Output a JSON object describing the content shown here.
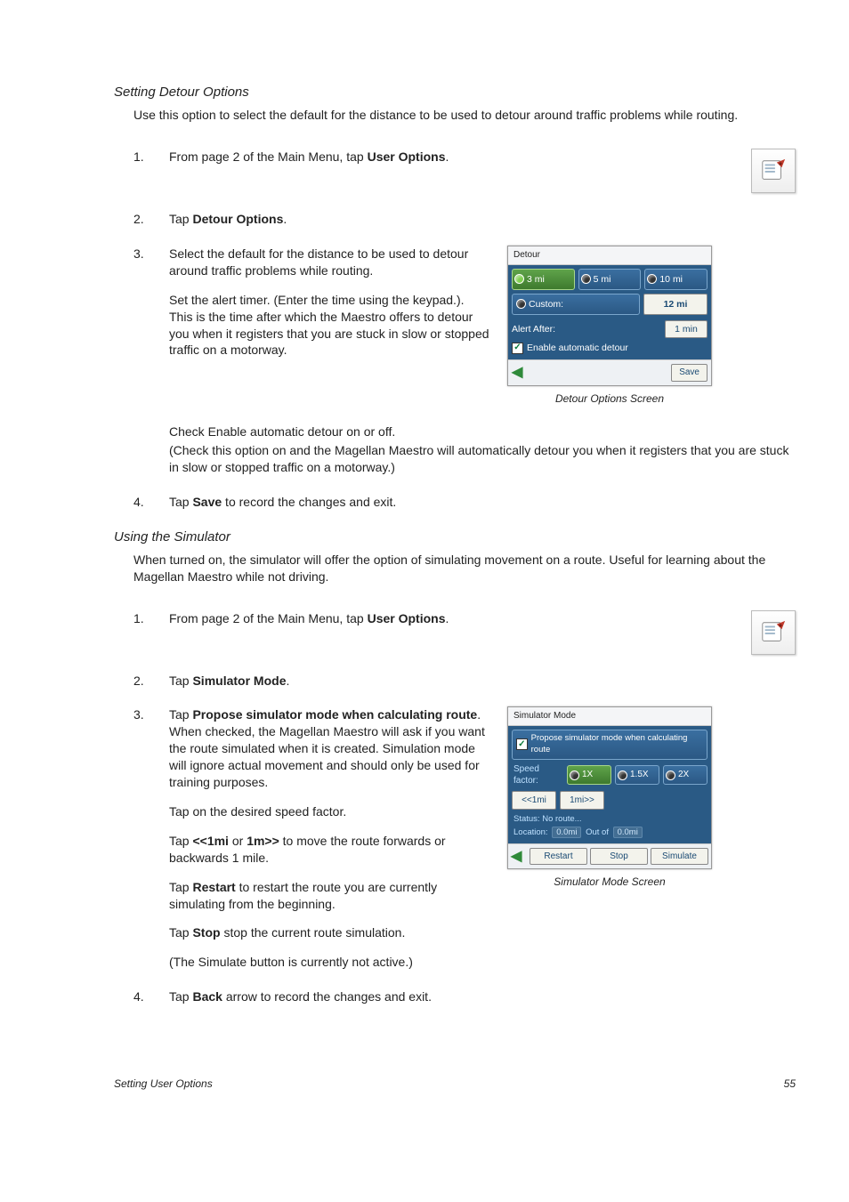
{
  "section1": {
    "title": "Setting Detour Options",
    "intro": "Use this option to select the default for the distance to be used to detour around traffic problems while routing.",
    "steps": {
      "s1": {
        "num": "1.",
        "pre": "From page 2 of the Main Menu, tap ",
        "bold": "User Options",
        "post": "."
      },
      "s2": {
        "num": "2.",
        "pre": "Tap ",
        "bold": "Detour Options",
        "post": "."
      },
      "s3": {
        "num": "3.",
        "p1": "Select the default for the distance to be used to detour around traffic problems while routing.",
        "p2": "Set the alert timer.  (Enter the time using the keypad.). This is the time after which the Maestro offers to detour you when it registers that you are stuck in slow or stopped traffic on a motorway.",
        "p3a": "Check Enable automatic detour on or off.",
        "p3b": "(Check this option on and the Magellan Maestro will automatically detour you when it registers that you are stuck in slow or stopped traffic on a motorway.)"
      },
      "s4": {
        "num": "4.",
        "pre": "Tap ",
        "bold": "Save",
        "post": " to record the changes and exit."
      }
    },
    "figure": {
      "title": "Detour",
      "opts": {
        "a": "3 mi",
        "b": "5 mi",
        "c": "10 mi"
      },
      "custom_label": "Custom:",
      "custom_val": "12 mi",
      "alert_label": "Alert After:",
      "alert_val": "1 min",
      "enable_label": "Enable automatic detour",
      "save": "Save",
      "caption": "Detour Options Screen"
    }
  },
  "section2": {
    "title": "Using the Simulator",
    "intro": "When turned on, the simulator will offer the option of simulating movement on a route.  Useful for learning about the Magellan Maestro while not driving.",
    "steps": {
      "s1": {
        "num": "1.",
        "pre": "From page 2 of the Main Menu, tap ",
        "bold": "User Options",
        "post": "."
      },
      "s2": {
        "num": "2.",
        "pre": "Tap ",
        "bold": "Simulator Mode",
        "post": "."
      },
      "s3": {
        "num": "3.",
        "p1_pre": "Tap ",
        "p1_bold": "Propose simulator mode when calculating route",
        "p1_post": ".  When checked, the Magellan Maestro will ask if you want the route simulated when it is created.  Simulation mode will ignore actual movement and should only be used for training purposes.",
        "p2": "Tap on the desired speed factor.",
        "p3_pre": "Tap ",
        "p3_b1": "<<1mi",
        "p3_mid": " or ",
        "p3_b2": "1m>>",
        "p3_post": " to move the route forwards or backwards 1 mile.",
        "p4_pre": "Tap ",
        "p4_bold": "Restart",
        "p4_post": " to restart the route you are currently simulating from the beginning.",
        "p5_pre": "Tap  ",
        "p5_bold": "Stop",
        "p5_post": " stop the current route simulation.",
        "p6": "(The Simulate button is currently not active.)"
      },
      "s4": {
        "num": "4.",
        "pre": "Tap ",
        "bold": "Back",
        "post": " arrow to record the changes and exit."
      }
    },
    "figure": {
      "title": "Simulator Mode",
      "propose": "Propose simulator mode when calculating route",
      "speed_label": "Speed factor:",
      "speeds": {
        "a": "1X",
        "b": "1.5X",
        "c": "2X"
      },
      "mile_back": "<<1mi",
      "mile_fwd": "1mi>>",
      "status": "Status: No route...",
      "loc_label": "Location:",
      "loc_a": "0.0mi",
      "loc_mid": "Out of",
      "loc_b": "0.0mi",
      "restart": "Restart",
      "stop": "Stop",
      "simulate": "Simulate",
      "caption": "Simulator Mode Screen"
    }
  },
  "footer": {
    "left": "Setting User Options",
    "right": "55"
  }
}
